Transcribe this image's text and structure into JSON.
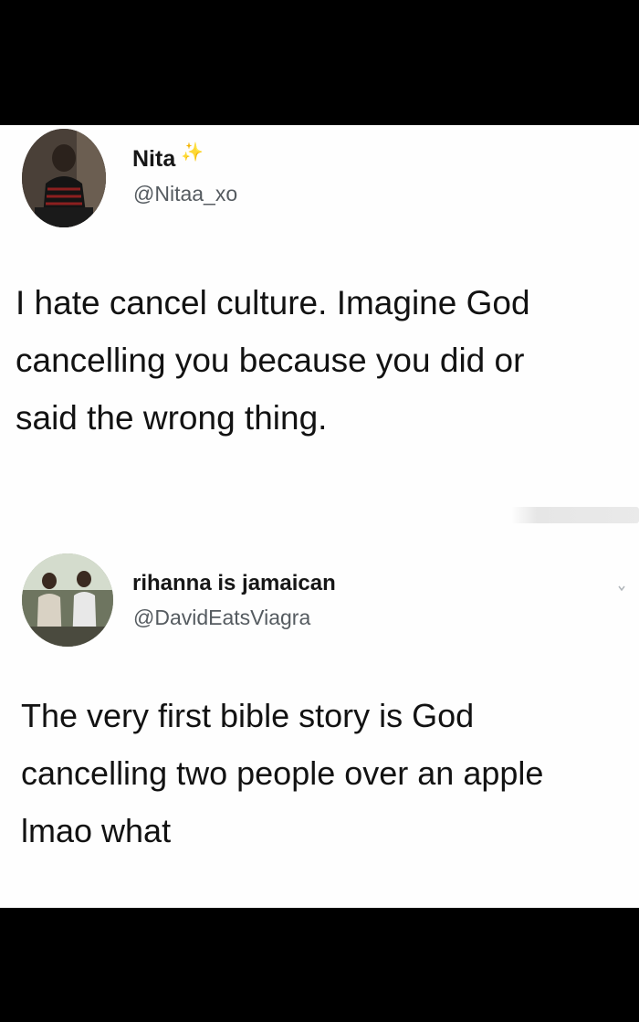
{
  "tweets": [
    {
      "display_name": "Nita",
      "name_decoration": "✨",
      "handle": "@Nitaa_xo",
      "text": "I hate cancel culture. Imagine God\ncancelling you because you did or\nsaid the wrong thing."
    },
    {
      "display_name": "rihanna is jamaican",
      "handle": "@DavidEatsViagra",
      "text": "The very first bible story is God\ncancelling two people over an apple\nlmao what"
    }
  ],
  "icons": {
    "sparkle": "sparkle-icon",
    "chevron": "chevron-down-icon"
  },
  "colors": {
    "background": "#000000",
    "panel": "#fefefe",
    "text": "#121212",
    "handle": "#555b60",
    "sparkle": "#e3c245"
  }
}
